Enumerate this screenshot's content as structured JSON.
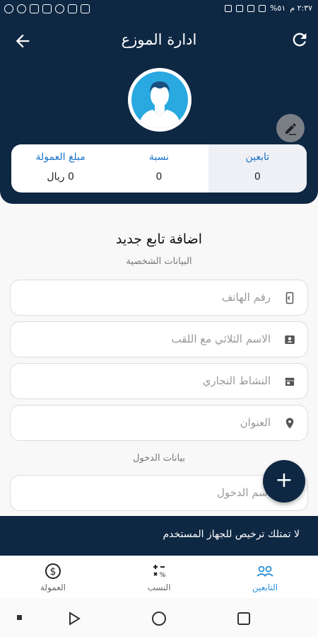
{
  "status_bar": {
    "time": "٢:٣٧ م",
    "battery": "%٥١"
  },
  "header": {
    "title": "ادارة الموزع"
  },
  "stats": [
    {
      "label": "مبلغ العمولة",
      "value": "0 ريال"
    },
    {
      "label": "نسبة",
      "value": "0"
    },
    {
      "label": "تابعين",
      "value": "0"
    }
  ],
  "form": {
    "title": "اضافة تابع جديد",
    "personal_section": "البيانات الشخصية",
    "login_section": "بيانات الدخول",
    "phone_placeholder": "رقم الهاتف",
    "name_placeholder": "الاسم الثلاثي مع اللقب",
    "activity_placeholder": "النشاط التجاري",
    "address_placeholder": "العنوان",
    "username_placeholder": "اسم الدخول"
  },
  "fab_label": "+",
  "banner": {
    "text": "لا تمتلك ترخيص للجهاز المستخدم"
  },
  "bottom_nav": [
    {
      "label": "العمولة"
    },
    {
      "label": "النسب"
    },
    {
      "label": "التابعين"
    }
  ],
  "colors": {
    "primary": "#0e2743",
    "accent": "#1b73c9",
    "avatar_bg": "#29a9e0"
  }
}
